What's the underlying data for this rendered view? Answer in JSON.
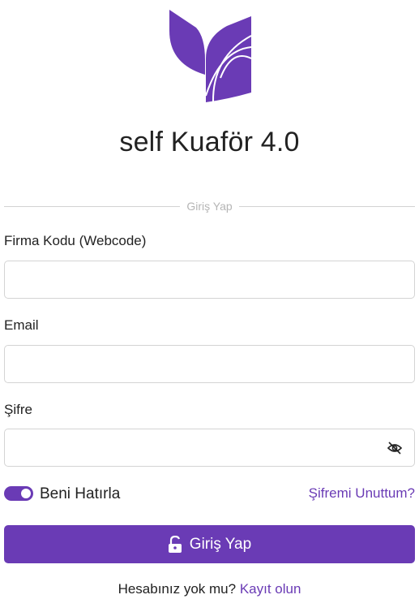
{
  "app": {
    "title": "self Kuaför 4.0",
    "brand_color": "#6a3bb5"
  },
  "form": {
    "section_title": "Giriş Yap",
    "firma_kodu": {
      "label": "Firma Kodu (Webcode)",
      "value": ""
    },
    "email": {
      "label": "Email",
      "value": ""
    },
    "sifre": {
      "label": "Şifre",
      "value": "",
      "toggle_icon": "eye-slash-icon"
    },
    "remember_me": {
      "label": "Beni Hatırla",
      "checked": true
    },
    "forgot_password": "Şifremi Unuttum?",
    "submit": {
      "label": "Giriş Yap",
      "icon": "lock-open-icon"
    },
    "signup_prompt": "Hesabınız yok mu?",
    "signup_link": "Kayıt olun"
  }
}
